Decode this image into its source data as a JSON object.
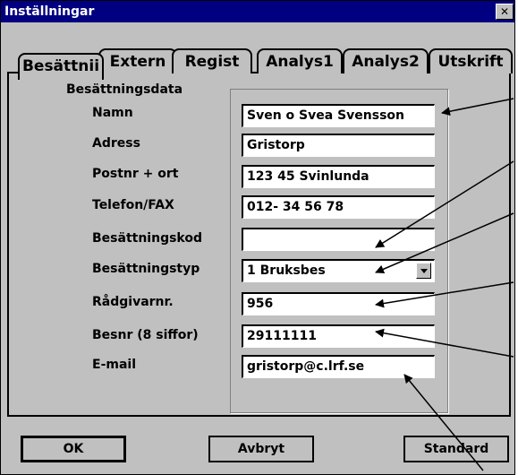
{
  "window": {
    "title": "Inställningar"
  },
  "tabs": [
    {
      "label": "Besättnii"
    },
    {
      "label": "Extern"
    },
    {
      "label": "Regist"
    },
    {
      "label": "Analys1"
    },
    {
      "label": "Analys2"
    },
    {
      "label": "Utskrift"
    }
  ],
  "section_title": "Besättningsdata",
  "fields": {
    "namn": {
      "label": "Namn",
      "value": "Sven o Svea Svensson"
    },
    "adress": {
      "label": "Adress",
      "value": "Gristorp"
    },
    "postnr": {
      "label": "Postnr + ort",
      "value": "123 45 Svinlunda"
    },
    "telefon": {
      "label": "Telefon/FAX",
      "value": "012- 34 56 78"
    },
    "kod": {
      "label": "Besättningskod",
      "value": ""
    },
    "typ": {
      "label": "Besättningstyp",
      "value": "1 Bruksbes"
    },
    "radgivare": {
      "label": "Rådgivarnr.",
      "value": "956"
    },
    "besnr": {
      "label": "Besnr (8 siffor)",
      "value": "29111111"
    },
    "email": {
      "label": "E-mail",
      "value": "gristorp@c.lrf.se"
    }
  },
  "buttons": {
    "ok": "OK",
    "cancel": "Avbryt",
    "default": "Standard"
  }
}
